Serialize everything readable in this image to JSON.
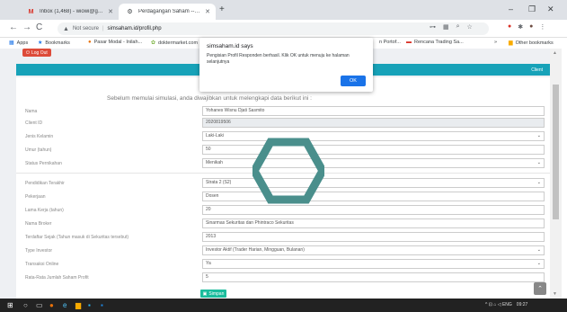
{
  "browser": {
    "tabs": [
      {
        "title": "Inbox (1,468) - wiowi@gmail.com",
        "icon": "gmail-icon"
      },
      {
        "title": "Perdagangan Saham -- Simulasi",
        "icon": "page-icon"
      }
    ],
    "nav": {
      "back": "←",
      "forward": "→",
      "reload": "C"
    },
    "security": "Not secure",
    "url": "simsaham.id/profil.php",
    "window": {
      "minimize": "–",
      "maximize": "❐",
      "close": "✕"
    },
    "bookmarks": [
      {
        "label": "Apps"
      },
      {
        "label": "Bookmarks"
      },
      {
        "label": "Pasar Modal - Inilah..."
      },
      {
        "label": "doktermarket.com"
      },
      {
        "label": "n Portof..."
      },
      {
        "label": "Rencana Trading Sa..."
      },
      {
        "label": "»"
      },
      {
        "label": "Other bookmarks"
      }
    ]
  },
  "page": {
    "logout_label": "Log Out",
    "banner_right": "Client",
    "intro": "Sebelum memulai simulasi, anda diwajibkan untuk melengkapi data berikut ini :",
    "fields": [
      {
        "label": "Nama",
        "value": "Yohanes Wisnu Djati Sasmito",
        "readonly": false,
        "select": false
      },
      {
        "label": "Client ID",
        "value": "2020819506",
        "readonly": true,
        "select": false
      },
      {
        "label": "Jenis Kelamin",
        "value": "Laki-Laki",
        "readonly": false,
        "select": true
      },
      {
        "label": "Umur (tahun)",
        "value": "50",
        "readonly": false,
        "select": false
      },
      {
        "label": "Status Pernikahan",
        "value": "Menikah",
        "readonly": false,
        "select": true
      },
      {
        "label": "Pendidikan Terakhir",
        "value": "Strata 2 (S2)",
        "readonly": false,
        "select": true
      },
      {
        "label": "Pekerjaan",
        "value": "Dosen",
        "readonly": false,
        "select": false
      },
      {
        "label": "Lama Kerja (tahun)",
        "value": "20",
        "readonly": false,
        "select": false
      },
      {
        "label": "Nama Broker",
        "value": "Sinarmas Sekuritas dan Phintraco Sekuritas",
        "readonly": false,
        "select": false
      },
      {
        "label": "Terdaftar Sejak (Tahun masuk di Sekuritas tersebut)",
        "value": "2013",
        "readonly": false,
        "select": false
      },
      {
        "label": "Type Investor",
        "value": "Investor Aktif (Trader Harian, Mingguan, Bulanan)",
        "readonly": false,
        "select": true
      },
      {
        "label": "Transaksi Online",
        "value": "Ya",
        "readonly": false,
        "select": true
      },
      {
        "label": "Rata-Rata Jumlah Saham Profit",
        "value": "5",
        "readonly": false,
        "select": false
      }
    ],
    "save_label": "Simpan"
  },
  "dialog": {
    "title": "simsaham.id says",
    "message": "Pengisian Profil Responden berhasil. Klik OK untuk menuju ke halaman selanjutnya",
    "ok_label": "OK"
  },
  "taskbar": {
    "tray_text": "^ ⊡ ⌂ ◁ ENG",
    "time": "09:27"
  },
  "colors": {
    "banner": "#17a2b8",
    "save_button": "#1abc9c",
    "logout_button": "#dd4b39",
    "dialog_ok": "#1a73e8",
    "logo_hexagon": "#4a8f8c"
  }
}
